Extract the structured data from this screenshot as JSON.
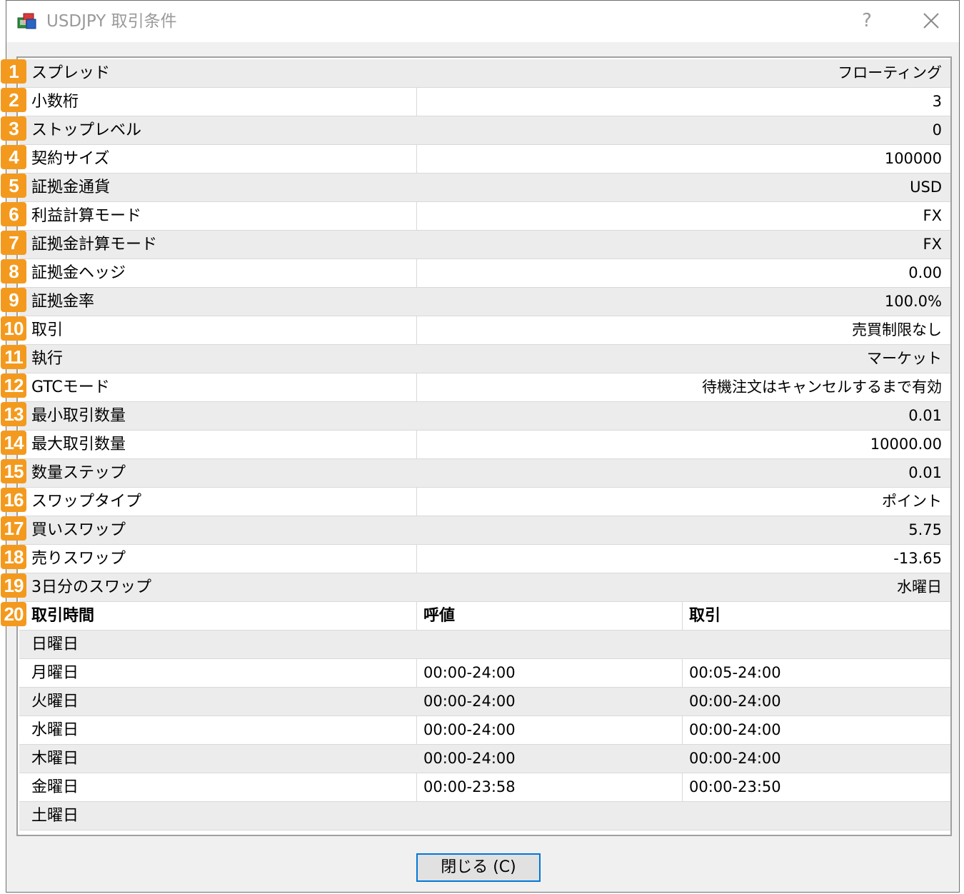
{
  "window": {
    "title": "USDJPY 取引条件",
    "help_label": "?",
    "close_button_label": "閉じる (C)"
  },
  "colors": {
    "badge": "#f39a1e",
    "row_shade": "#ececec",
    "focus_border": "#0078d7"
  },
  "properties": [
    {
      "num": "1",
      "label": "スプレッド",
      "value": "フローティング"
    },
    {
      "num": "2",
      "label": "小数桁",
      "value": "3"
    },
    {
      "num": "3",
      "label": "ストップレベル",
      "value": "0"
    },
    {
      "num": "4",
      "label": "契約サイズ",
      "value": "100000"
    },
    {
      "num": "5",
      "label": "証拠金通貨",
      "value": "USD"
    },
    {
      "num": "6",
      "label": "利益計算モード",
      "value": "FX"
    },
    {
      "num": "7",
      "label": "証拠金計算モード",
      "value": "FX"
    },
    {
      "num": "8",
      "label": "証拠金ヘッジ",
      "value": "0.00"
    },
    {
      "num": "9",
      "label": "証拠金率",
      "value": "100.0%"
    },
    {
      "num": "10",
      "label": "取引",
      "value": "売買制限なし"
    },
    {
      "num": "11",
      "label": "執行",
      "value": "マーケット"
    },
    {
      "num": "12",
      "label": "GTCモード",
      "value": "待機注文はキャンセルするまで有効"
    },
    {
      "num": "13",
      "label": "最小取引数量",
      "value": "0.01"
    },
    {
      "num": "14",
      "label": "最大取引数量",
      "value": "10000.00"
    },
    {
      "num": "15",
      "label": "数量ステップ",
      "value": "0.01"
    },
    {
      "num": "16",
      "label": "スワップタイプ",
      "value": "ポイント"
    },
    {
      "num": "17",
      "label": "買いスワップ",
      "value": "5.75"
    },
    {
      "num": "18",
      "label": "売りスワップ",
      "value": "-13.65"
    },
    {
      "num": "19",
      "label": "3日分のスワップ",
      "value": "水曜日"
    }
  ],
  "sessions": {
    "num": "20",
    "headers": [
      "取引時間",
      "呼値",
      "取引"
    ],
    "rows": [
      {
        "day": "日曜日",
        "quote": "",
        "trade": ""
      },
      {
        "day": "月曜日",
        "quote": "00:00-24:00",
        "trade": "00:05-24:00"
      },
      {
        "day": "火曜日",
        "quote": "00:00-24:00",
        "trade": "00:00-24:00"
      },
      {
        "day": "水曜日",
        "quote": "00:00-24:00",
        "trade": "00:00-24:00"
      },
      {
        "day": "木曜日",
        "quote": "00:00-24:00",
        "trade": "00:00-24:00"
      },
      {
        "day": "金曜日",
        "quote": "00:00-23:58",
        "trade": "00:00-23:50"
      },
      {
        "day": "土曜日",
        "quote": "",
        "trade": ""
      }
    ]
  }
}
